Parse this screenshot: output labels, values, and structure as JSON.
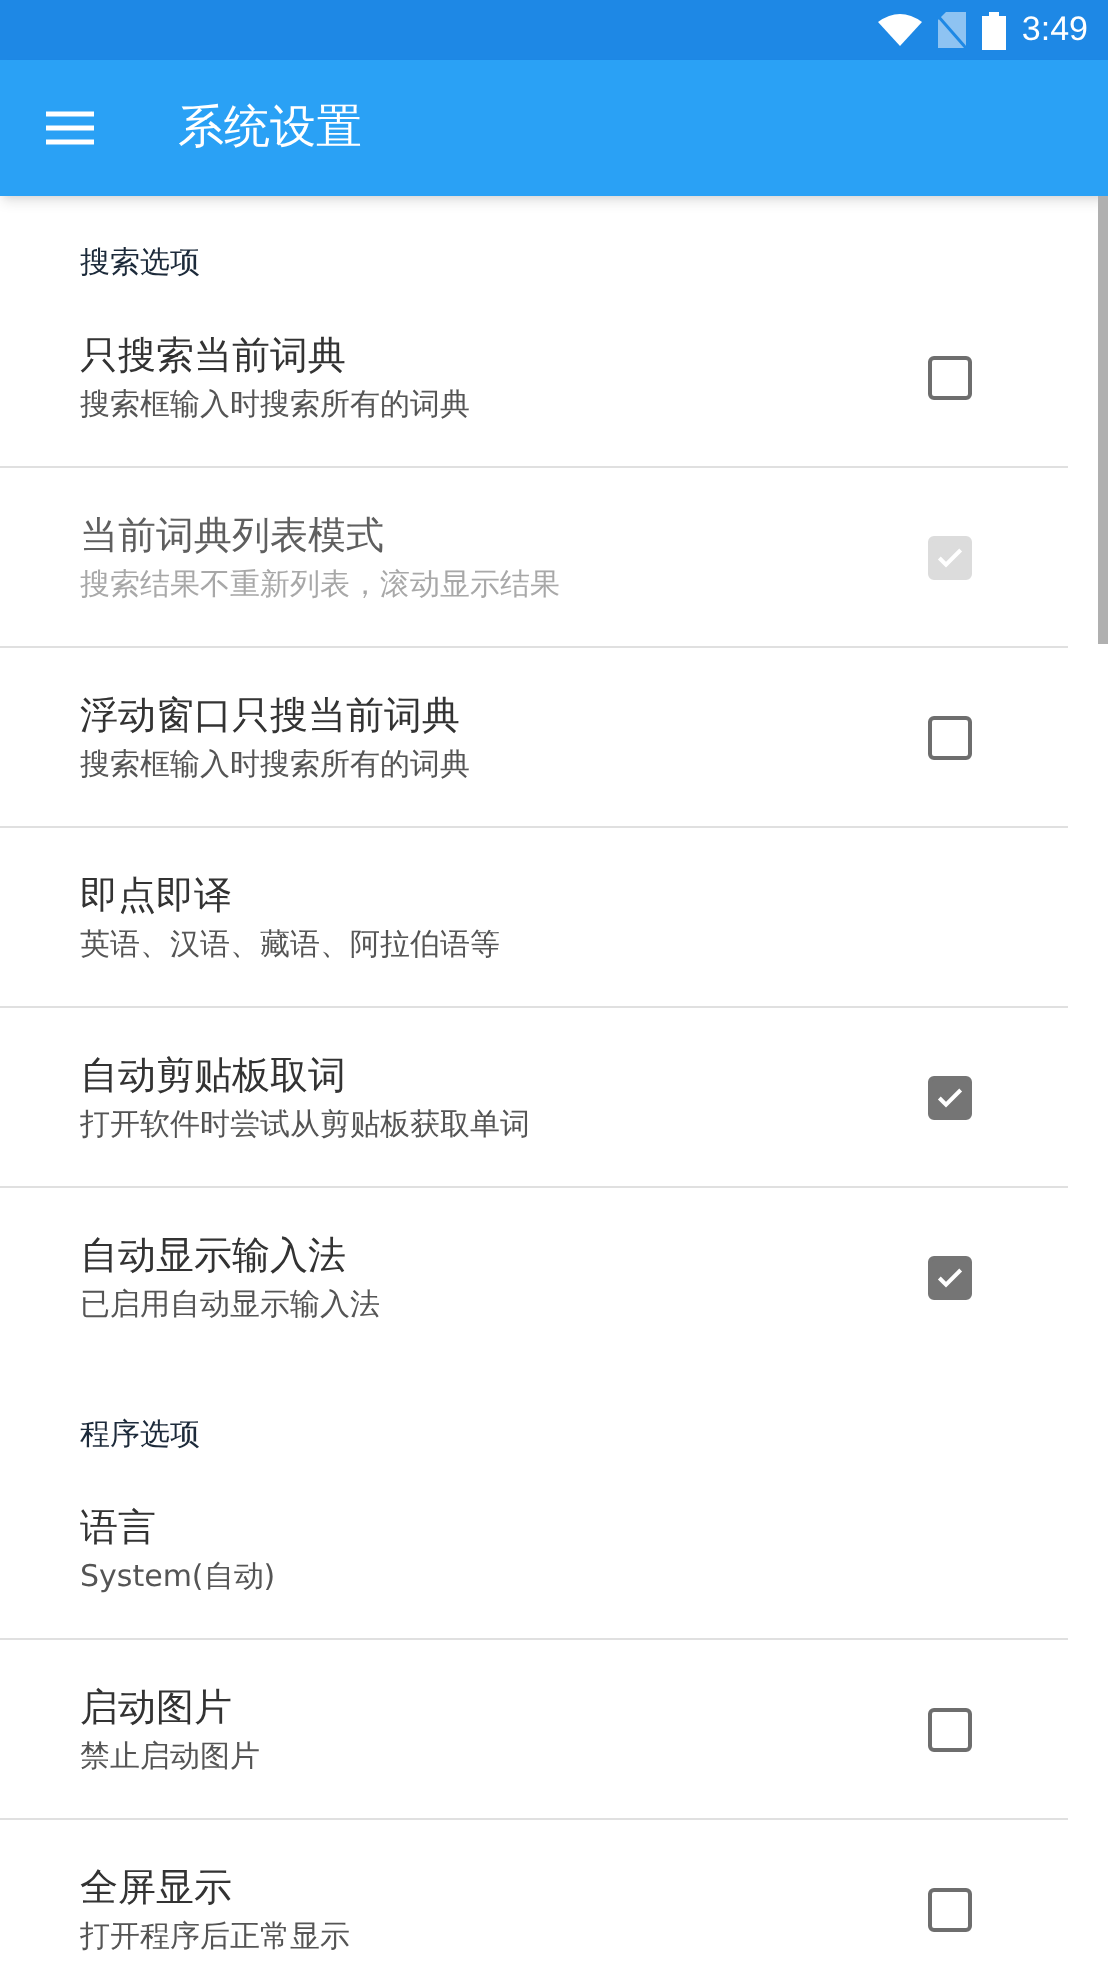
{
  "status_bar": {
    "time": "3:49"
  },
  "app_bar": {
    "title": "系统设置"
  },
  "sections": [
    {
      "title": "搜索选项",
      "items": [
        {
          "kind": "checkbox",
          "title": "只搜索当前词典",
          "summary": "搜索框输入时搜索所有的词典",
          "checked": false,
          "disabled": false
        },
        {
          "kind": "checkbox",
          "title": "当前词典列表模式",
          "summary": "搜索结果不重新列表，滚动显示结果",
          "checked": true,
          "disabled": true
        },
        {
          "kind": "checkbox",
          "title": "浮动窗口只搜当前词典",
          "summary": "搜索框输入时搜索所有的词典",
          "checked": false,
          "disabled": false
        },
        {
          "kind": "plain",
          "title": "即点即译",
          "summary": "英语、汉语、藏语、阿拉伯语等"
        },
        {
          "kind": "checkbox",
          "title": "自动剪贴板取词",
          "summary": "打开软件时尝试从剪贴板获取单词",
          "checked": true,
          "disabled": false
        },
        {
          "kind": "checkbox",
          "title": "自动显示输入法",
          "summary": "已启用自动显示输入法",
          "checked": true,
          "disabled": false
        }
      ]
    },
    {
      "title": "程序选项",
      "items": [
        {
          "kind": "plain",
          "title": "语言",
          "summary": "System(自动)"
        },
        {
          "kind": "checkbox",
          "title": "启动图片",
          "summary": "禁止启动图片",
          "checked": false,
          "disabled": false
        },
        {
          "kind": "checkbox",
          "title": "全屏显示",
          "summary": "打开程序后正常显示",
          "checked": false,
          "disabled": false
        }
      ]
    }
  ]
}
